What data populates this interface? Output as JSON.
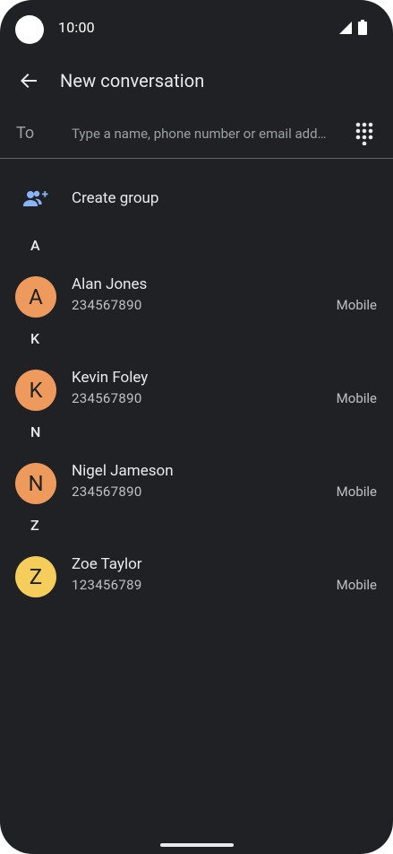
{
  "status_bar": {
    "time": "10:00"
  },
  "app_bar": {
    "title": "New conversation",
    "back_icon": "arrow-back-icon"
  },
  "recipient": {
    "label": "To",
    "placeholder": "Type a name, phone number or email add…",
    "value": "",
    "dialpad_icon": "dialpad-icon"
  },
  "create_group": {
    "label": "Create group",
    "icon": "group-add-icon"
  },
  "sections": [
    {
      "letter": "A",
      "contacts": [
        {
          "initial": "A",
          "name": "Alan Jones",
          "number": "234567890",
          "type": "Mobile",
          "color": "#ee9a5c"
        }
      ]
    },
    {
      "letter": "K",
      "contacts": [
        {
          "initial": "K",
          "name": "Kevin Foley",
          "number": "234567890",
          "type": "Mobile",
          "color": "#ee9a5c"
        }
      ]
    },
    {
      "letter": "N",
      "contacts": [
        {
          "initial": "N",
          "name": "Nigel Jameson",
          "number": "234567890",
          "type": "Mobile",
          "color": "#ee9a5c"
        }
      ]
    },
    {
      "letter": "Z",
      "contacts": [
        {
          "initial": "Z",
          "name": "Zoe Taylor",
          "number": "123456789",
          "type": "Mobile",
          "color": "#f5cd5a"
        }
      ]
    }
  ],
  "colors": {
    "background": "#202124",
    "accent": "#8ab4f8",
    "divider": "#5f6368"
  }
}
